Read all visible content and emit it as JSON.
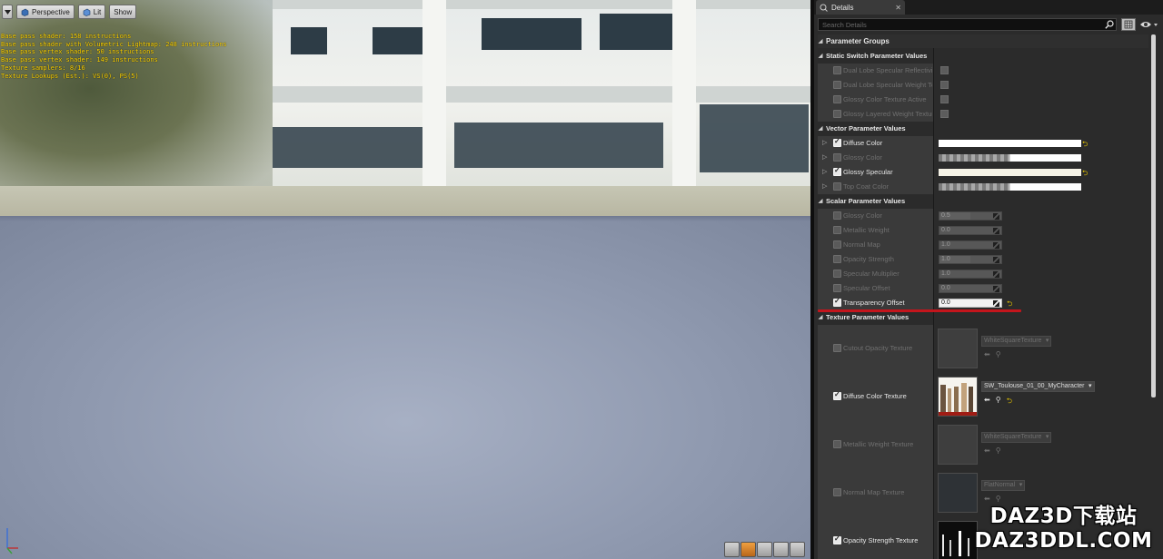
{
  "viewport": {
    "toolbar": {
      "perspective_label": "Perspective",
      "lit_label": "Lit",
      "show_label": "Show"
    },
    "stats": [
      "Base pass shader: 158 instructions",
      "Base pass shader with Volumetric Lightmap: 248 instructions",
      "Base pass vertex shader: 50 instructions",
      "Base pass vertex shader: 149 instructions",
      "Texture samplers: 8/16",
      "Texture Lookups (Est.): VS(0), PS(5)"
    ],
    "stat_color": "#ffd400"
  },
  "details": {
    "tab_title": "Details",
    "search_placeholder": "Search Details",
    "parameter_groups_label": "Parameter Groups",
    "static_switch": {
      "title": "Static Switch Parameter Values",
      "items": [
        {
          "name": "Dual Lobe Specular Reflectivity",
          "enabled": false
        },
        {
          "name": "Dual Lobe Specular Weight Texture",
          "enabled": false
        },
        {
          "name": "Glossy Color Texture Active",
          "enabled": false
        },
        {
          "name": "Glossy Layered Weight Texture",
          "enabled": false
        }
      ]
    },
    "vector": {
      "title": "Vector Parameter Values",
      "items": [
        {
          "name": "Diffuse Color",
          "enabled": true,
          "swatch": "#ffffff"
        },
        {
          "name": "Glossy Color",
          "enabled": false,
          "swatch": "checker"
        },
        {
          "name": "Glossy Specular",
          "enabled": true,
          "swatch": "#f5f2e6"
        },
        {
          "name": "Top Coat Color",
          "enabled": false,
          "swatch": "checker"
        }
      ]
    },
    "scalar": {
      "title": "Scalar Parameter Values",
      "items": [
        {
          "name": "Glossy Color",
          "value": "0.5",
          "enabled": false
        },
        {
          "name": "Metallic Weight",
          "value": "0.0",
          "enabled": false
        },
        {
          "name": "Normal Map",
          "value": "1.0",
          "enabled": false
        },
        {
          "name": "Opacity Strength",
          "value": "1.0",
          "enabled": false
        },
        {
          "name": "Specular Multiplier",
          "value": "1.0",
          "enabled": false
        },
        {
          "name": "Specular Offset",
          "value": "0.0",
          "enabled": false
        },
        {
          "name": "Transparency Offset",
          "value": "0.0",
          "enabled": true
        }
      ]
    },
    "texture": {
      "title": "Texture Parameter Values",
      "items": [
        {
          "name": "Cutout Opacity Texture",
          "asset": "WhiteSquareTexture",
          "enabled": false
        },
        {
          "name": "Diffuse Color Texture",
          "asset": "SW_Toulouse_01_00_MyCharacter",
          "enabled": true
        },
        {
          "name": "Metallic Weight Texture",
          "asset": "WhiteSquareTexture",
          "enabled": false
        },
        {
          "name": "Normal Map Texture",
          "asset": "FlatNormal",
          "enabled": false
        },
        {
          "name": "Opacity Strength Texture",
          "asset": "",
          "enabled": true
        }
      ]
    },
    "highlight_color": "#c4151c"
  },
  "watermark": {
    "line1": "DAZ3D下载站",
    "line2": "DAZ3DDL.COM"
  }
}
